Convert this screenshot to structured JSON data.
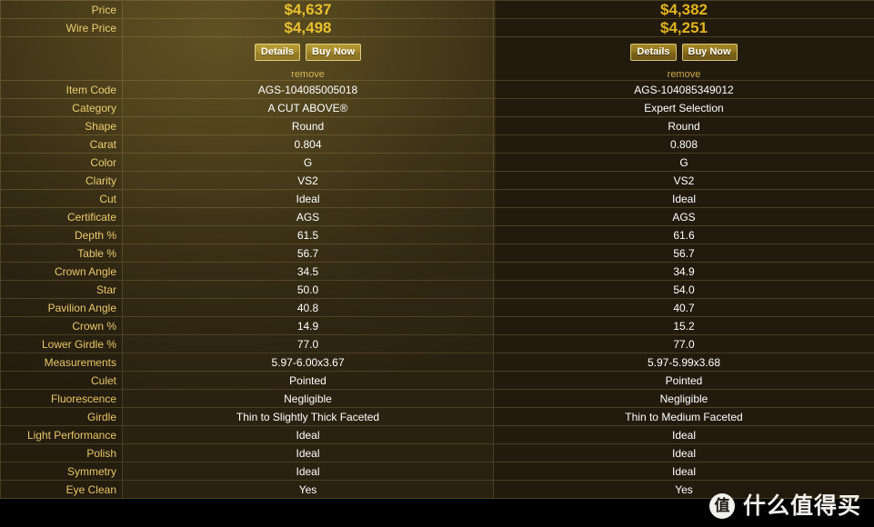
{
  "colors": {
    "page_background": "#000000",
    "table_background": "#211a0c",
    "column_a_background": "#2a2210",
    "column_b_background": "#221b0d",
    "grid_line": "#4a3f22",
    "label_text": "#e9c66a",
    "value_text": "#ffffff",
    "price_text": "#e3b320",
    "button_gold": "#8e7320",
    "button_border": "#d9c27a",
    "remove_link": "#caa84a"
  },
  "table": {
    "columns": [
      {
        "key": "label",
        "header": ""
      },
      {
        "key": "diamond_a",
        "header": ""
      },
      {
        "key": "diamond_b",
        "header": ""
      }
    ],
    "rows": [
      {
        "label": "Price",
        "a": "$4,637",
        "b": "$4,382",
        "style": "price"
      },
      {
        "label": "Wire Price",
        "a": "$4,498",
        "b": "$4,251",
        "style": "wire"
      },
      {
        "label": "",
        "a": "",
        "b": "",
        "style": "actions"
      },
      {
        "label": "Item Code",
        "a": "AGS-104085005018",
        "b": "AGS-104085349012",
        "style": "data"
      },
      {
        "label": "Category",
        "a": "A CUT ABOVE®",
        "b": "Expert Selection",
        "style": "data"
      },
      {
        "label": "Shape",
        "a": "Round",
        "b": "Round",
        "style": "data"
      },
      {
        "label": "Carat",
        "a": "0.804",
        "b": "0.808",
        "style": "data"
      },
      {
        "label": "Color",
        "a": "G",
        "b": "G",
        "style": "data"
      },
      {
        "label": "Clarity",
        "a": "VS2",
        "b": "VS2",
        "style": "data"
      },
      {
        "label": "Cut",
        "a": "Ideal",
        "b": "Ideal",
        "style": "data"
      },
      {
        "label": "Certificate",
        "a": "AGS",
        "b": "AGS",
        "style": "data"
      },
      {
        "label": "Depth %",
        "a": "61.5",
        "b": "61.6",
        "style": "data"
      },
      {
        "label": "Table %",
        "a": "56.7",
        "b": "56.7",
        "style": "data"
      },
      {
        "label": "Crown Angle",
        "a": "34.5",
        "b": "34.9",
        "style": "data"
      },
      {
        "label": "Star",
        "a": "50.0",
        "b": "54.0",
        "style": "data"
      },
      {
        "label": "Pavilion Angle",
        "a": "40.8",
        "b": "40.7",
        "style": "data"
      },
      {
        "label": "Crown %",
        "a": "14.9",
        "b": "15.2",
        "style": "data"
      },
      {
        "label": "Lower Girdle %",
        "a": "77.0",
        "b": "77.0",
        "style": "data"
      },
      {
        "label": "Measurements",
        "a": "5.97-6.00x3.67",
        "b": "5.97-5.99x3.68",
        "style": "data"
      },
      {
        "label": "Culet",
        "a": "Pointed",
        "b": "Pointed",
        "style": "data"
      },
      {
        "label": "Fluorescence",
        "a": "Negligible",
        "b": "Negligible",
        "style": "data"
      },
      {
        "label": "Girdle",
        "a": "Thin to Slightly Thick Faceted",
        "b": "Thin to Medium Faceted",
        "style": "girdle"
      },
      {
        "label": "Light Performance",
        "a": "Ideal",
        "b": "Ideal",
        "style": "data"
      },
      {
        "label": "Polish",
        "a": "Ideal",
        "b": "Ideal",
        "style": "data"
      },
      {
        "label": "Symmetry",
        "a": "Ideal",
        "b": "Ideal",
        "style": "data"
      },
      {
        "label": "Eye Clean",
        "a": "Yes",
        "b": "Yes",
        "style": "data"
      }
    ]
  },
  "actions": {
    "details_label": "Details",
    "buy_now_label": "Buy Now",
    "remove_label": "remove"
  },
  "watermark": {
    "badge_glyph": "值",
    "text": "什么值得买"
  }
}
